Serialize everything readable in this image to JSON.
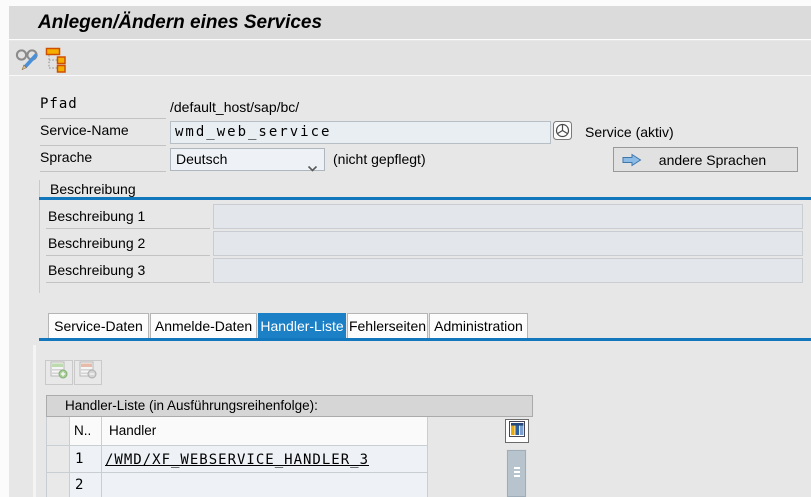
{
  "window": {
    "title": "Anlegen/Ändern eines Services"
  },
  "toolbar": {
    "icons": {
      "display_change": "glasses-pencil",
      "hierarchy": "tree-orange-squares"
    }
  },
  "form": {
    "pfad": {
      "label": "Pfad",
      "value": "/default_host/sap/bc/"
    },
    "service_name": {
      "label": "Service-Name",
      "value": "wmd_web_service"
    },
    "service_status": "Service (aktiv)",
    "sprache": {
      "label": "Sprache",
      "value": "Deutsch",
      "note": "(nicht gepflegt)"
    },
    "andere_sprachen_label": "andere Sprachen"
  },
  "beschreibung": {
    "header": "Beschreibung",
    "rows": [
      {
        "label": "Beschreibung 1",
        "value": ""
      },
      {
        "label": "Beschreibung 2",
        "value": ""
      },
      {
        "label": "Beschreibung 3",
        "value": ""
      }
    ]
  },
  "tabs": [
    {
      "label": "Service-Daten",
      "active": false
    },
    {
      "label": "Anmelde-Daten",
      "active": false
    },
    {
      "label": "Handler-Liste",
      "active": true
    },
    {
      "label": "Fehlerseiten",
      "active": false
    },
    {
      "label": "Administration",
      "active": false
    }
  ],
  "handler_table": {
    "title": "Handler-Liste (in Ausführungsreihenfolge):",
    "columns": {
      "n": "N..",
      "handler": "Handler"
    },
    "rows": [
      {
        "n": "1",
        "handler": "/WMD/XF_WEBSERVICE_HANDLER_3"
      },
      {
        "n": "2",
        "handler": ""
      }
    ]
  },
  "icons": {
    "object": "cube-in-circle",
    "dropdown": "chevron-down",
    "andere_sprachen": "blue-arrow-right",
    "insert_row": "table-row-plus-green",
    "delete_row": "table-row-minus-orange",
    "column_config": "three-column-bars"
  },
  "colors": {
    "active_tab": "#1b80c6",
    "section_line": "#1377be",
    "field_bg": "#e9eef3",
    "table_row_bg": "#eef2f6",
    "scrollbar_thumb": "#b7c3cd",
    "insert_green": "#7cc05e",
    "delete_orange": "#e8936a",
    "config_gold": "#e8a90a",
    "config_blue": "#2e5f9e"
  }
}
